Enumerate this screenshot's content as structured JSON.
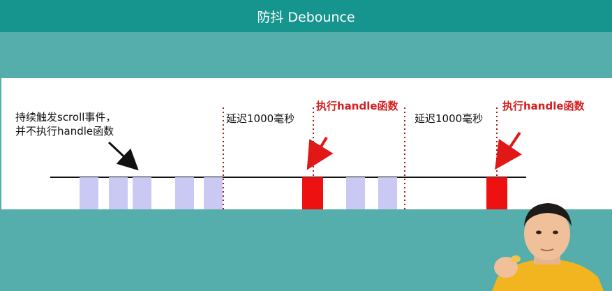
{
  "header": {
    "title": "防抖 Debounce"
  },
  "diagram": {
    "note_line1": "持续触发scroll事件，",
    "note_line2": "并不执行handle函数",
    "delay_label_1": "延迟1000毫秒",
    "delay_label_2": "延迟1000毫秒",
    "exec_label_1": "执行handle函数",
    "exec_label_2": "执行handle函数"
  },
  "colors": {
    "header_bg": "#16958f",
    "background": "#55aeac",
    "event_block": "#c9c9f3",
    "exec_block": "#ee1111",
    "dotted_line": "#a31515",
    "red_text": "#d42020"
  }
}
